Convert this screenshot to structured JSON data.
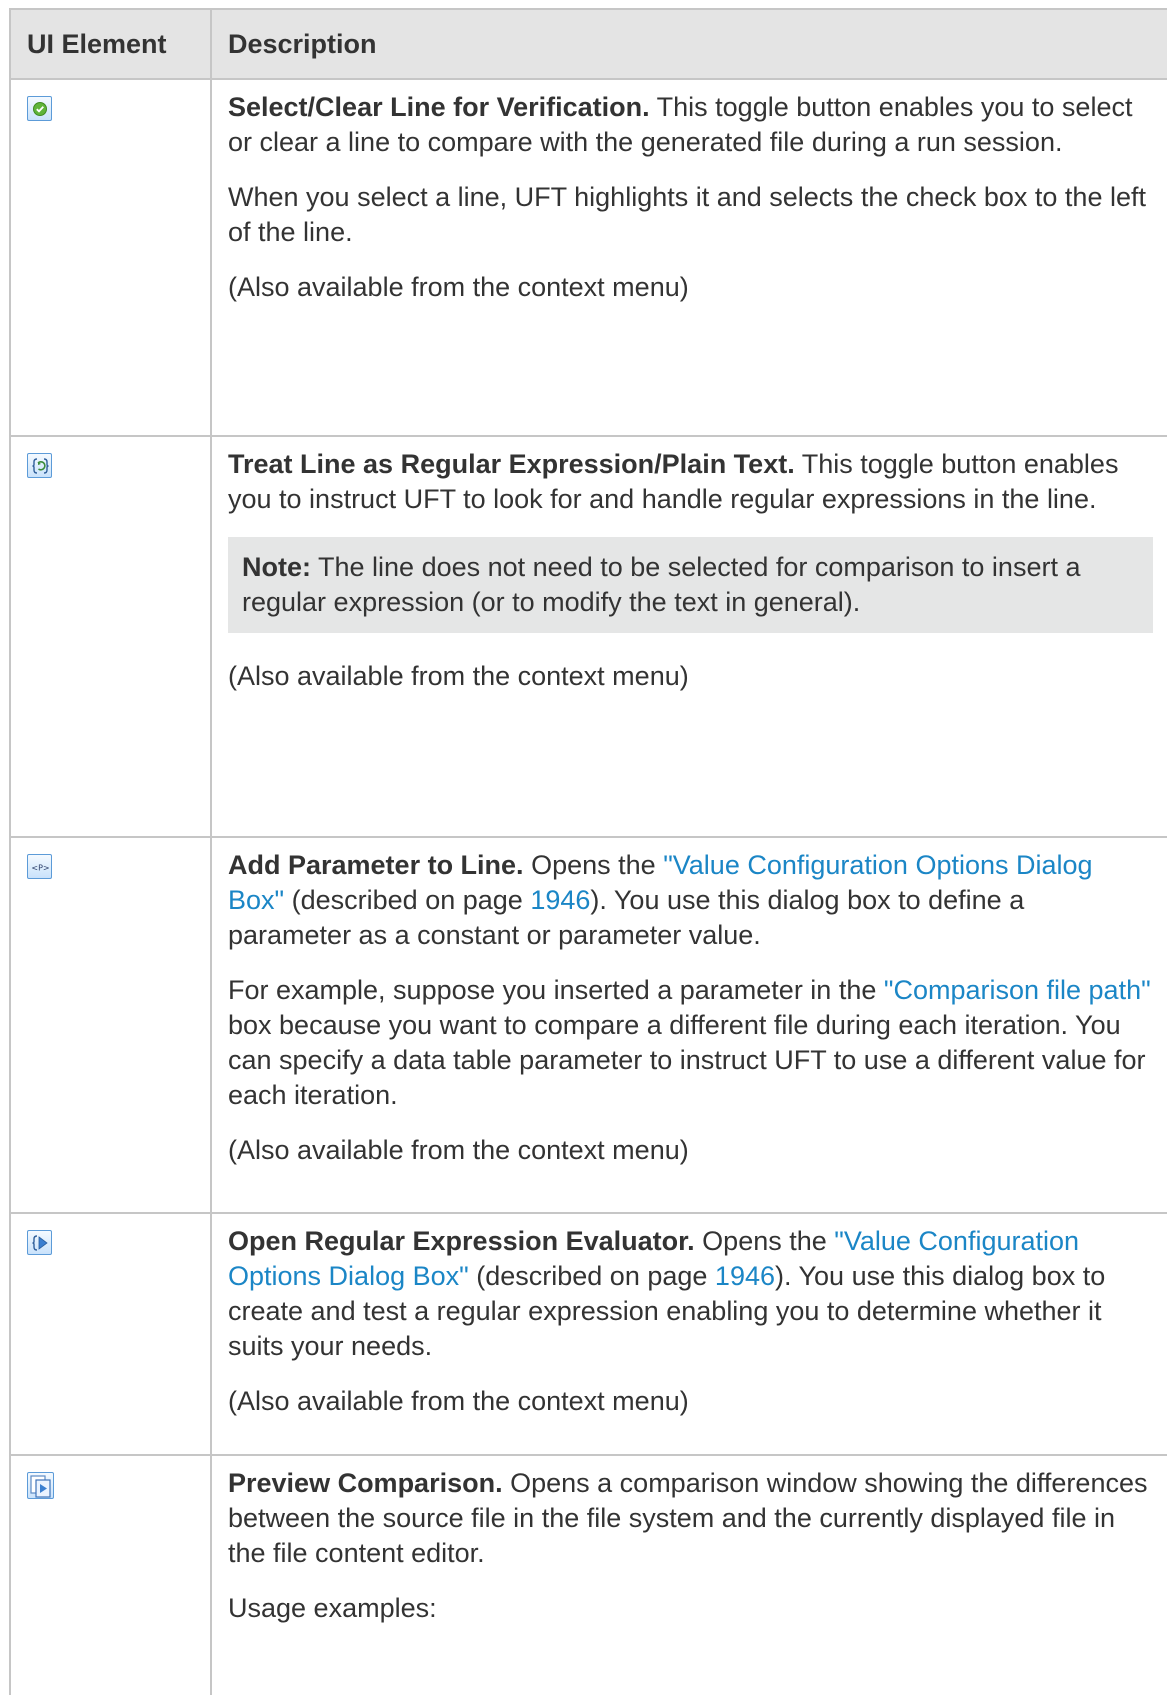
{
  "header": {
    "col1": "UI Element",
    "col2": "Description"
  },
  "rows": [
    {
      "icon": "check-circle-icon",
      "title": "Select/Clear Line for Verification.",
      "p1": "This toggle button enables you to select or clear a line to compare with the generated file during a run session.",
      "p2": "When you select a line, UFT highlights it and selects the check box to the left of the line.",
      "p3": "(Also available from the context menu)"
    },
    {
      "icon": "regex-toggle-icon",
      "title": "Treat Line as Regular Expression/Plain Text.",
      "p1": "This toggle button enables you to instruct UFT to look for and handle regular expressions in the line.",
      "note_label": "Note:",
      "note_text": "The line does not need to be selected for comparison to insert a regular expression (or to modify the text in general).",
      "p3": "(Also available from the context menu)"
    },
    {
      "icon": "parameter-icon",
      "title": "Add Parameter to Line.",
      "p1_before": "Opens the",
      "p1_link": "\"Value Configuration Options Dialog Box\"",
      "p1_mid": "(described on page",
      "p1_page": "1946",
      "p1_after": "). You use this dialog box to define a parameter as a constant or parameter value.",
      "p2_before": "For example, suppose you inserted a parameter in the",
      "p2_link": "\"Comparison file path\"",
      "p2_after": "box because you want to compare a different file during each iteration. You can specify a data table parameter to instruct UFT to use a different value for each iteration.",
      "p3": "(Also available from the context menu)"
    },
    {
      "icon": "regex-evaluator-icon",
      "title": "Open Regular Expression Evaluator.",
      "p1_before": "Opens the",
      "p1_link": "\"Value Configuration Options Dialog Box\"",
      "p1_mid": "(described on page",
      "p1_page": "1946",
      "p1_after": "). You use this dialog box to create and test a regular expression enabling you to determine whether it suits your needs.",
      "p3": "(Also available from the context menu)"
    },
    {
      "icon": "preview-comparison-icon",
      "title": "Preview Comparison.",
      "p1": "Opens a comparison window showing the differences between the source file in the file system and the currently displayed file in the file content editor.",
      "p2": "Usage examples:"
    }
  ]
}
